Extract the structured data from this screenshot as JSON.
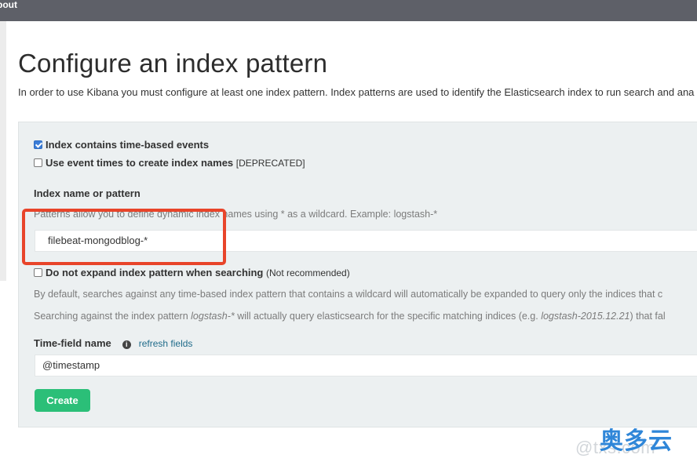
{
  "topbar": {
    "about_label": "bout"
  },
  "page": {
    "title": "Configure an index pattern",
    "intro": "In order to use Kibana you must configure at least one index pattern. Index patterns are used to identify the Elasticsearch index to run search and ana"
  },
  "form": {
    "time_based": {
      "label": "Index contains time-based events",
      "checked": true
    },
    "event_times": {
      "label": "Use event times to create index names",
      "note": "[DEPRECATED]",
      "checked": false
    },
    "index_name_label": "Index name or pattern",
    "index_help": "Patterns allow you to define dynamic index names using * as a wildcard. Example: logstash-*",
    "index_value": "filebeat-mongodblog-*",
    "no_expand": {
      "label": "Do not expand index pattern when searching",
      "note": "(Not recommended)",
      "checked": false
    },
    "expand_help_1": "By default, searches against any time-based index pattern that contains a wildcard will automatically be expanded to query only the indices that c",
    "expand_help_2_prefix": "Searching against the index pattern ",
    "expand_help_2_em1": "logstash-*",
    "expand_help_2_mid": " will actually query elasticsearch for the specific matching indices (e.g. ",
    "expand_help_2_em2": "logstash-2015.12.21",
    "expand_help_2_suffix": ") that fal",
    "time_field_label": "Time-field name",
    "info_icon": "info-icon",
    "refresh_link": "refresh fields",
    "time_field_value": "@timestamp",
    "create_button": "Create"
  },
  "colors": {
    "create_button": "#2bbf78",
    "highlight_box": "#e8442a",
    "checkbox_checked": "#3b7dd8",
    "topbar": "#5e6068"
  },
  "watermark": {
    "text": "@txs.com",
    "brand": "奥多云"
  }
}
